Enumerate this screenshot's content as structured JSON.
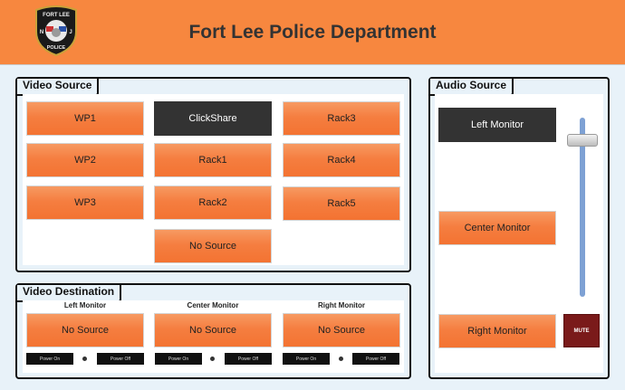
{
  "header": {
    "title": "Fort Lee Police Department",
    "badge": {
      "top": "FORT LEE",
      "left": "N",
      "right": "J",
      "bottom": "POLICE"
    }
  },
  "video_source": {
    "label": "Video Source",
    "buttons": [
      "WP1",
      "ClickShare",
      "Rack3",
      "WP2",
      "Rack1",
      "Rack4",
      "WP3",
      "Rack2",
      "Rack5",
      "No Source"
    ],
    "selected": "ClickShare"
  },
  "video_destination": {
    "label": "Video Destination",
    "columns": [
      {
        "title": "Left Monitor",
        "source": "No Source",
        "power_on": "Power On",
        "power_off": "Power Off"
      },
      {
        "title": "Center Monitor",
        "source": "No Source",
        "power_on": "Power On",
        "power_off": "Power Off"
      },
      {
        "title": "Right Monitor",
        "source": "No Source",
        "power_on": "Power On",
        "power_off": "Power Off"
      }
    ]
  },
  "audio_source": {
    "label": "Audio Source",
    "buttons": [
      "Left Monitor",
      "Center Monitor",
      "Right Monitor"
    ],
    "selected": "Left Monitor",
    "mute_label": "MUTE",
    "volume_level": 0.88
  },
  "colors": {
    "header": "#f7873f",
    "button": "#f57e40",
    "selected": "#333333",
    "mute": "#7a1a1a",
    "slider": "#7ea1d4"
  }
}
